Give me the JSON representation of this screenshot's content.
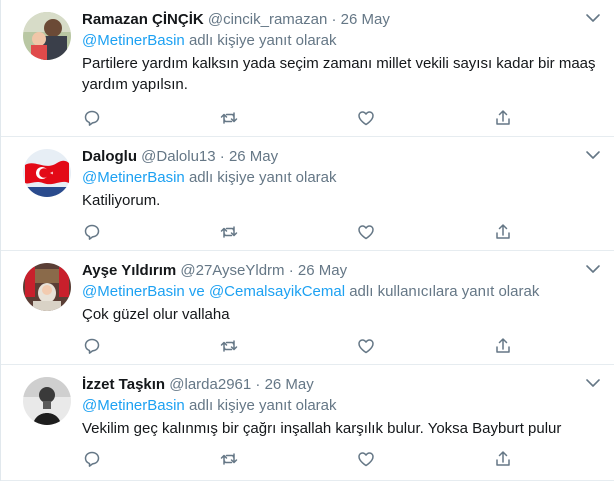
{
  "tweets": [
    {
      "name": "Ramazan ÇİNÇİK",
      "handle": "@cincik_ramazan",
      "sep": "·",
      "date": "26 May",
      "reply_mentions": "@MetinerBasin",
      "reply_suffix": "adlı kişiye yanıt olarak",
      "text": "Partilere yardım kalksın yada seçim zamanı millet vekili sayısı kadar  bir maaş yardım yapılsın.",
      "avatar_icon": "person-with-baby-avatar"
    },
    {
      "name": "Daloglu",
      "handle": "@Dalolu13",
      "sep": "·",
      "date": "26 May",
      "reply_mentions": "@MetinerBasin",
      "reply_suffix": "adlı kişiye yanıt olarak",
      "text": "Katiliyorum.",
      "avatar_icon": "turkish-flag-avatar"
    },
    {
      "name": "Ayşe Yıldırım",
      "handle": "@27AyseYldrm",
      "sep": "·",
      "date": "26 May",
      "reply_mentions": "@MetinerBasin ve @CemalsayikCemal",
      "reply_suffix": "adlı kullanıcılara yanıt olarak",
      "text": "Çok güzel olur vallaha",
      "avatar_icon": "woman-with-flags-avatar"
    },
    {
      "name": "İzzet Taşkın",
      "handle": "@larda2961",
      "sep": "·",
      "date": "26 May",
      "reply_mentions": "@MetinerBasin",
      "reply_suffix": "adlı kişiye yanıt olarak",
      "text": "Vekilim geç kalınmış bir çağrı inşallah karşılık bulur. Yoksa Bayburt pulur",
      "avatar_icon": "grayscale-portrait-avatar"
    }
  ],
  "colors": {
    "link": "#1da1f2",
    "secondary": "#657786",
    "text": "#14171a",
    "divider": "#e6ecf0"
  },
  "icons": [
    "reply-icon",
    "retweet-icon",
    "like-icon",
    "share-icon",
    "chevron-down-icon"
  ]
}
